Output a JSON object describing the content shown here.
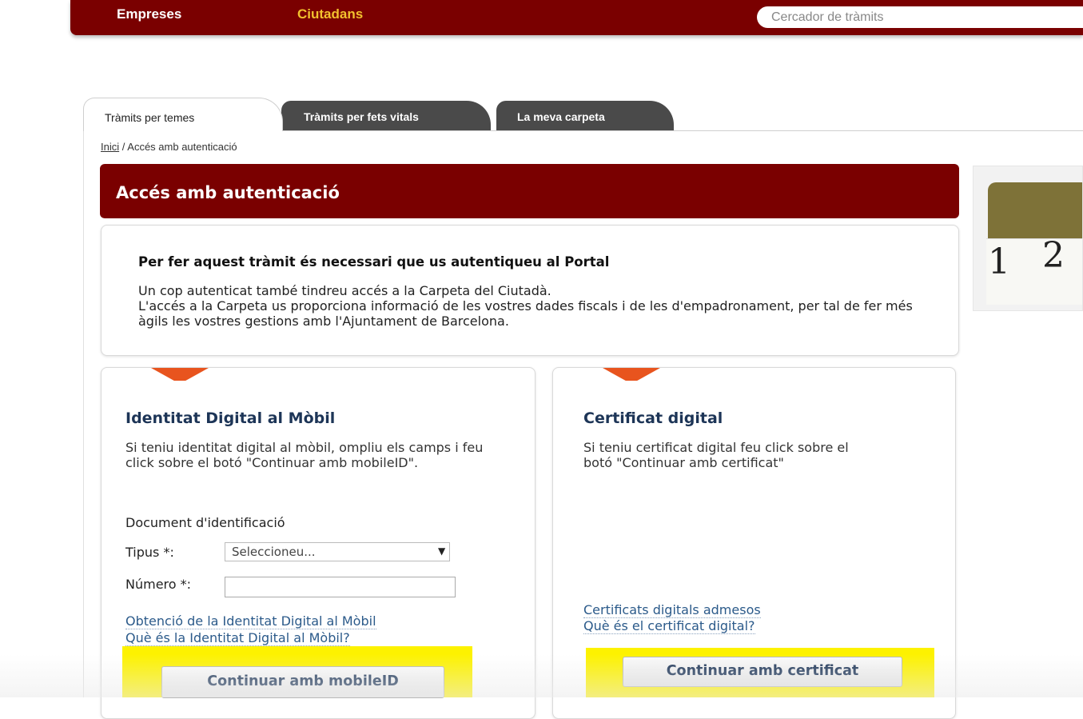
{
  "topbar": {
    "nav": [
      "Empreses",
      "Ciutadans"
    ],
    "search_placeholder": "Cercador de tràmits",
    "colors": {
      "bar": "#7a0000",
      "active_nav": "#f2c12e"
    }
  },
  "tabs": [
    {
      "label": "Tràmits per temes",
      "active": true
    },
    {
      "label": "Tràmits per fets vitals",
      "active": false
    },
    {
      "label": "La meva carpeta",
      "active": false
    }
  ],
  "breadcrumb": {
    "home": "Inici",
    "separator": "/",
    "current": "Accés amb autenticació"
  },
  "page_title": "Accés amb autenticació",
  "info": {
    "heading": "Per fer aquest tràmit és necessari que us autentiqueu al Portal",
    "line1": "Un cop autenticat també tindreu accés a la Carpeta del Ciutadà.",
    "line2": "L'accés a la Carpeta us proporciona informació de les vostres dades fiscals i de les d'empadronament, per tal de fer més àgils les vostres gestions amb l'Ajuntament de Barcelona."
  },
  "mobile": {
    "title": "Identitat Digital al Mòbil",
    "description": "Si teniu identitat digital al mòbil, ompliu els camps i feu click sobre el botó \"Continuar amb mobileID\".",
    "doc_label": "Document d'identificació",
    "tipus_label": "Tipus *:",
    "tipus_value": "Seleccioneu...",
    "numero_label": "Número *:",
    "numero_value": "",
    "link1": "Obtenció de la Identitat Digital al Mòbil",
    "link2": "Què és la Identitat Digital al Mòbil?",
    "button": "Continuar amb mobileID"
  },
  "certificate": {
    "title": "Certificat digital",
    "description": "Si teniu certificat digital feu click sobre el botó \"Continuar amb certificat\"",
    "link1": "Certificats digitals admesos",
    "link2": "Què és el certificat digital?",
    "button": "Continuar amb certificat"
  },
  "side_image": {
    "numbers": [
      "1",
      "2"
    ]
  },
  "highlight_color": "#fdf200"
}
